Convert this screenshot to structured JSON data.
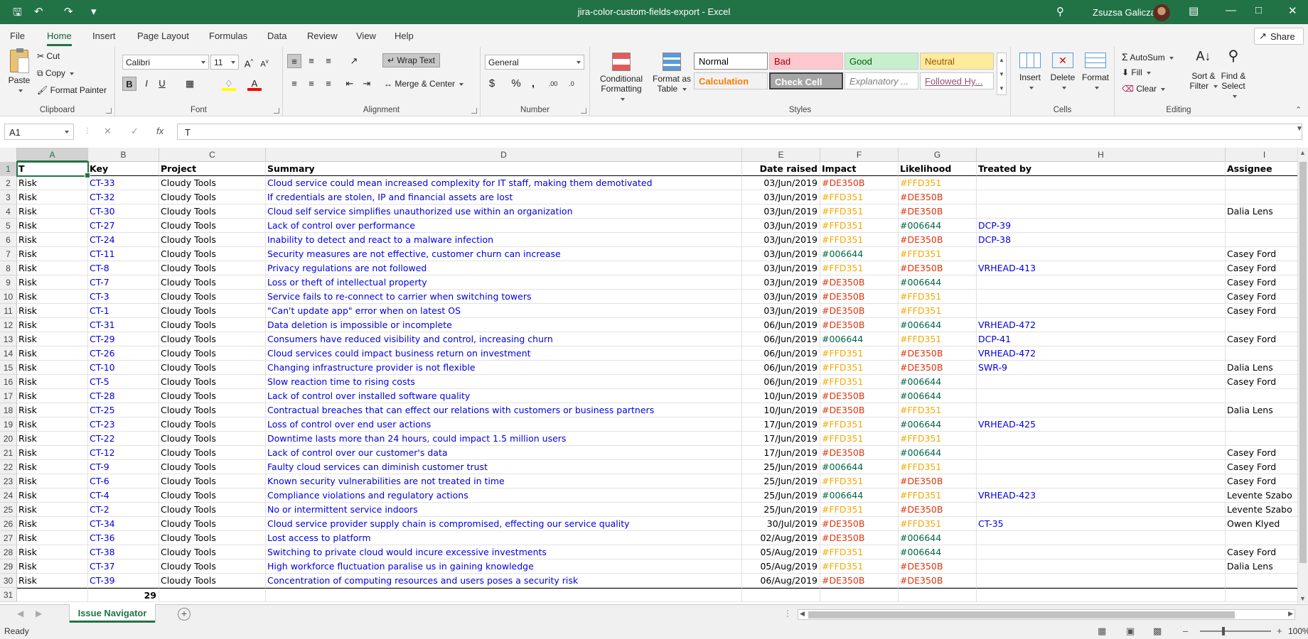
{
  "window": {
    "title": "jira-color-custom-fields-export  -  Excel",
    "user": "Zsuzsa Galicza"
  },
  "menu": {
    "tabs": [
      "File",
      "Home",
      "Insert",
      "Page Layout",
      "Formulas",
      "Data",
      "Review",
      "View",
      "Help"
    ],
    "active": "Home",
    "share": "Share"
  },
  "ribbon": {
    "clipboard": {
      "label": "Clipboard",
      "paste": "Paste",
      "cut": "Cut",
      "copy": "Copy",
      "format_painter": "Format Painter"
    },
    "font": {
      "label": "Font",
      "name": "Calibri",
      "size": "11"
    },
    "alignment": {
      "label": "Alignment",
      "wrap": "Wrap Text",
      "merge": "Merge & Center"
    },
    "number": {
      "label": "Number",
      "format": "General"
    },
    "styles": {
      "label": "Styles",
      "conditional": "Conditional Formatting",
      "format_table": "Format as Table",
      "cells": [
        {
          "name": "Normal",
          "bg": "#ffffff",
          "fg": "#000000"
        },
        {
          "name": "Bad",
          "bg": "#ffc7ce",
          "fg": "#9c0006"
        },
        {
          "name": "Good",
          "bg": "#c6efce",
          "fg": "#006100"
        },
        {
          "name": "Neutral",
          "bg": "#ffeb9c",
          "fg": "#9c5700"
        },
        {
          "name": "Calculation",
          "bg": "#f2f2f2",
          "fg": "#fa7d00"
        },
        {
          "name": "Check Cell",
          "bg": "#a5a5a5",
          "fg": "#ffffff"
        },
        {
          "name": "Explanatory ...",
          "bg": "#ffffff",
          "fg": "#7f7f7f"
        },
        {
          "name": "Followed Hy...",
          "bg": "#ffffff",
          "fg": "#954f72"
        }
      ]
    },
    "cells": {
      "label": "Cells",
      "insert": "Insert",
      "delete": "Delete",
      "format": "Format"
    },
    "editing": {
      "label": "Editing",
      "autosum": "AutoSum",
      "fill": "Fill",
      "clear": "Clear",
      "sort": "Sort & Filter",
      "find": "Find & Select"
    }
  },
  "formula_bar": {
    "name_box": "A1",
    "value": "T"
  },
  "sheet": {
    "columns": [
      {
        "letter": "A"
      },
      {
        "letter": "B"
      },
      {
        "letter": "C"
      },
      {
        "letter": "D"
      },
      {
        "letter": "E"
      },
      {
        "letter": "F"
      },
      {
        "letter": "G"
      },
      {
        "letter": "H"
      },
      {
        "letter": "I"
      }
    ],
    "headers": [
      "T",
      "Key",
      "Project",
      "Summary",
      "Date raised",
      "Impact",
      "Likelihood",
      "Treated by",
      "Assignee"
    ],
    "rows": [
      [
        "Risk",
        "CT-33",
        "Cloudy Tools",
        "Cloud service could mean increased complexity for IT staff, making them demotivated",
        "03/Jun/2019",
        "#DE350B",
        "#FFD351",
        "",
        ""
      ],
      [
        "Risk",
        "CT-32",
        "Cloudy Tools",
        "If credentials are stolen, IP and financial assets are lost",
        "03/Jun/2019",
        "#FFD351",
        "#DE350B",
        "",
        ""
      ],
      [
        "Risk",
        "CT-30",
        "Cloudy Tools",
        "Cloud self service simplifies unauthorized use within an organization",
        "03/Jun/2019",
        "#FFD351",
        "#DE350B",
        "",
        "Dalia Lens"
      ],
      [
        "Risk",
        "CT-27",
        "Cloudy Tools",
        "Lack of control over performance",
        "03/Jun/2019",
        "#FFD351",
        "#006644",
        "DCP-39",
        ""
      ],
      [
        "Risk",
        "CT-24",
        "Cloudy Tools",
        "Inability to detect and react to a malware infection",
        "03/Jun/2019",
        "#FFD351",
        "#DE350B",
        "DCP-38",
        ""
      ],
      [
        "Risk",
        "CT-11",
        "Cloudy Tools",
        "Security measures are not effective, customer churn can increase",
        "03/Jun/2019",
        "#006644",
        "#FFD351",
        "",
        "Casey Ford"
      ],
      [
        "Risk",
        "CT-8",
        "Cloudy Tools",
        "Privacy regulations are not followed",
        "03/Jun/2019",
        "#FFD351",
        "#DE350B",
        "VRHEAD-413",
        "Casey Ford"
      ],
      [
        "Risk",
        "CT-7",
        "Cloudy Tools",
        "Loss or theft of intellectual property",
        "03/Jun/2019",
        "#DE350B",
        "#006644",
        "",
        "Casey Ford"
      ],
      [
        "Risk",
        "CT-3",
        "Cloudy Tools",
        "Service fails to re-connect to carrier when switching towers",
        "03/Jun/2019",
        "#DE350B",
        "#FFD351",
        "",
        "Casey Ford"
      ],
      [
        "Risk",
        "CT-1",
        "Cloudy Tools",
        "\"Can't update app\" error when on latest OS",
        "03/Jun/2019",
        "#DE350B",
        "#FFD351",
        "",
        "Casey Ford"
      ],
      [
        "Risk",
        "CT-31",
        "Cloudy Tools",
        "Data deletion is impossible or incomplete",
        "06/Jun/2019",
        "#DE350B",
        "#006644",
        "VRHEAD-472",
        ""
      ],
      [
        "Risk",
        "CT-29",
        "Cloudy Tools",
        "Consumers have reduced visibility and control, increasing churn",
        "06/Jun/2019",
        "#006644",
        "#FFD351",
        "DCP-41",
        "Casey Ford"
      ],
      [
        "Risk",
        "CT-26",
        "Cloudy Tools",
        "Cloud services could impact business return on investment",
        "06/Jun/2019",
        "#FFD351",
        "#DE350B",
        "VRHEAD-472",
        ""
      ],
      [
        "Risk",
        "CT-10",
        "Cloudy Tools",
        "Changing infrastructure provider is not flexible",
        "06/Jun/2019",
        "#FFD351",
        "#DE350B",
        "SWR-9",
        "Dalia Lens"
      ],
      [
        "Risk",
        "CT-5",
        "Cloudy Tools",
        "Slow reaction time to rising costs",
        "06/Jun/2019",
        "#FFD351",
        "#006644",
        "",
        "Casey Ford"
      ],
      [
        "Risk",
        "CT-28",
        "Cloudy Tools",
        "Lack of control over installed software quality",
        "10/Jun/2019",
        "#DE350B",
        "#006644",
        "",
        ""
      ],
      [
        "Risk",
        "CT-25",
        "Cloudy Tools",
        "Contractual breaches that can effect our relations with customers or business partners",
        "10/Jun/2019",
        "#DE350B",
        "#FFD351",
        "",
        "Dalia Lens"
      ],
      [
        "Risk",
        "CT-23",
        "Cloudy Tools",
        "Loss of control over end user actions",
        "17/Jun/2019",
        "#FFD351",
        "#006644",
        "VRHEAD-425",
        ""
      ],
      [
        "Risk",
        "CT-22",
        "Cloudy Tools",
        "Downtime lasts more than 24 hours, could impact 1.5 million users",
        "17/Jun/2019",
        "#FFD351",
        "#FFD351",
        "",
        ""
      ],
      [
        "Risk",
        "CT-12",
        "Cloudy Tools",
        "Lack of control over our customer's data",
        "17/Jun/2019",
        "#DE350B",
        "#006644",
        "",
        "Casey Ford"
      ],
      [
        "Risk",
        "CT-9",
        "Cloudy Tools",
        "Faulty cloud services can diminish customer trust",
        "25/Jun/2019",
        "#006644",
        "#FFD351",
        "",
        "Casey Ford"
      ],
      [
        "Risk",
        "CT-6",
        "Cloudy Tools",
        "Known security vulnerabilities are not treated in time",
        "25/Jun/2019",
        "#FFD351",
        "#DE350B",
        "",
        "Casey Ford"
      ],
      [
        "Risk",
        "CT-4",
        "Cloudy Tools",
        "Compliance violations and regulatory actions",
        "25/Jun/2019",
        "#006644",
        "#FFD351",
        "VRHEAD-423",
        "Levente Szabo"
      ],
      [
        "Risk",
        "CT-2",
        "Cloudy Tools",
        "No or intermittent service indoors",
        "25/Jun/2019",
        "#FFD351",
        "#DE350B",
        "",
        "Levente Szabo"
      ],
      [
        "Risk",
        "CT-34",
        "Cloudy Tools",
        "Cloud service provider supply chain is compromised, effecting our service quality",
        "30/Jul/2019",
        "#DE350B",
        "#FFD351",
        "CT-35",
        "Owen Klyed"
      ],
      [
        "Risk",
        "CT-36",
        "Cloudy Tools",
        "Lost access to platform",
        "02/Aug/2019",
        "#DE350B",
        "#006644",
        "",
        ""
      ],
      [
        "Risk",
        "CT-38",
        "Cloudy Tools",
        "Switching to private cloud would incure excessive investments",
        "05/Aug/2019",
        "#FFD351",
        "#006644",
        "",
        "Casey Ford"
      ],
      [
        "Risk",
        "CT-37",
        "Cloudy Tools",
        "High workforce fluctuation paralise us in gaining knowledge",
        "05/Aug/2019",
        "#FFD351",
        "#DE350B",
        "",
        "Dalia Lens"
      ],
      [
        "Risk",
        "CT-39",
        "Cloudy Tools",
        "Concentration of computing resources and users poses a security risk",
        "06/Aug/2019",
        "#DE350B",
        "#DE350B",
        "",
        ""
      ]
    ],
    "total_row": {
      "row_number": "31",
      "count": "29"
    }
  },
  "sheet_tabs": {
    "active": "Issue Navigator"
  },
  "status": {
    "ready": "Ready",
    "zoom": "100%"
  },
  "colors": {
    "accent": "#217346",
    "link": "#0000e0",
    "red": "#DE350B",
    "yellow": "#FFD351",
    "green": "#006644"
  }
}
